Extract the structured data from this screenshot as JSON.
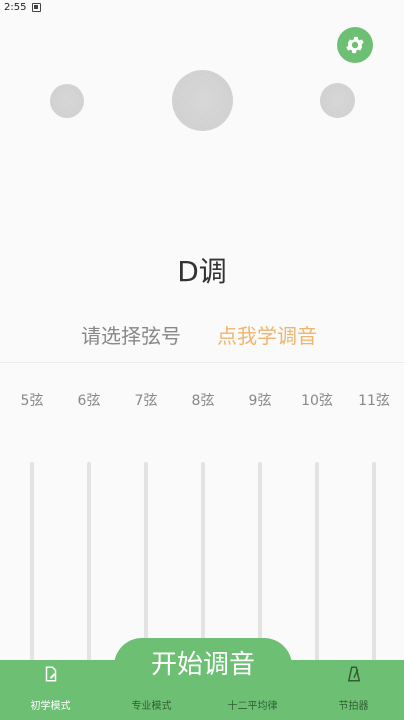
{
  "status_bar": {
    "time": "2:55"
  },
  "main": {
    "key_title": "D调",
    "prompt": "请选择弦号",
    "learn_link": "点我学调音",
    "start_button": "开始调音"
  },
  "strings": [
    {
      "label": "5弦"
    },
    {
      "label": "6弦"
    },
    {
      "label": "7弦"
    },
    {
      "label": "8弦"
    },
    {
      "label": "9弦"
    },
    {
      "label": "10弦"
    },
    {
      "label": "11弦"
    }
  ],
  "nav": {
    "items": [
      {
        "label": "初学模式",
        "icon": "beginner-icon",
        "active": true
      },
      {
        "label": "专业模式",
        "icon": "pro-icon",
        "active": false
      },
      {
        "label": "十二平均律",
        "icon": "temperament-icon",
        "active": false
      },
      {
        "label": "节拍器",
        "icon": "metronome-icon",
        "active": false
      }
    ]
  },
  "colors": {
    "accent_green": "#6dbf74",
    "link_orange": "#f0b56c"
  }
}
